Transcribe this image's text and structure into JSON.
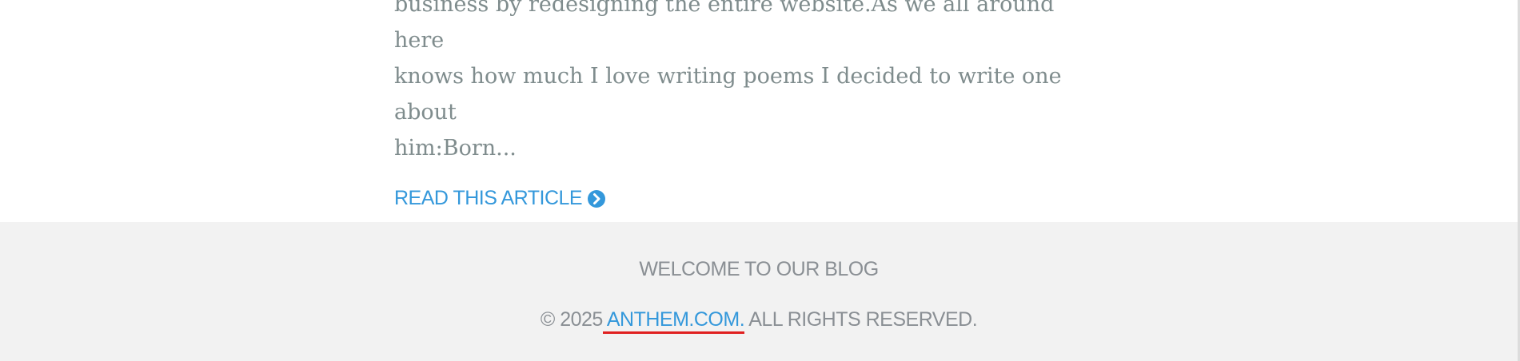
{
  "article": {
    "excerpt_lines": [
      "business by redesigning the entire website.As we all around here",
      "knows how much I love writing poems I decided to write one about",
      "him:Born..."
    ],
    "read_more_label": "READ THIS ARTICLE",
    "read_more_icon": "chevron-circle-right-icon"
  },
  "footer": {
    "title": "WELCOME TO OUR BLOG",
    "copyright_prefix": "© 2025",
    "site_link": " ANTHEM.COM.",
    "rights": " ALL RIGHTS RESERVED."
  },
  "colors": {
    "accent": "#3498db",
    "text_muted": "#7f8c8d",
    "footer_bg": "#f2f2f2",
    "link_underline": "#e02020"
  }
}
